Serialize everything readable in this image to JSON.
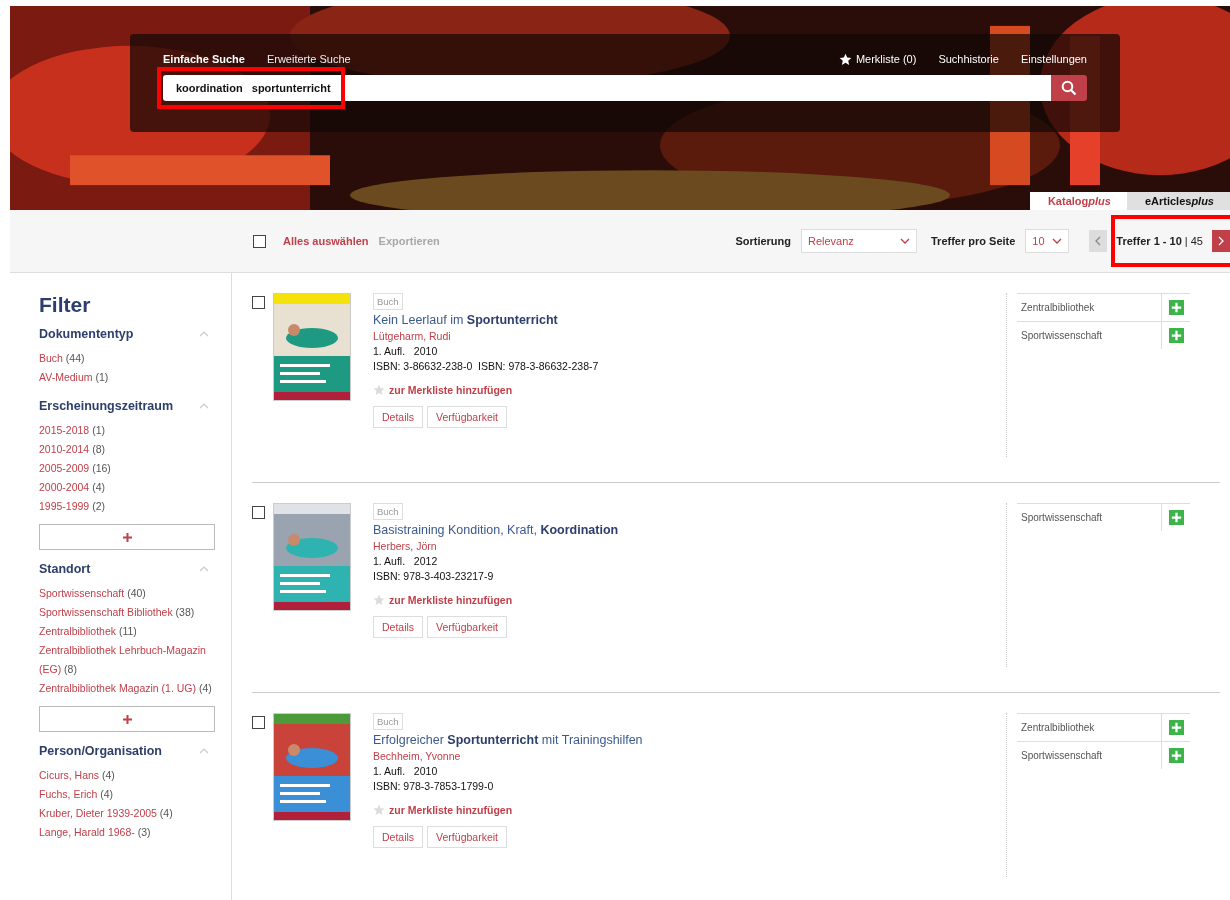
{
  "search": {
    "tabs": [
      {
        "label": "Einfache Suche",
        "selected": true
      },
      {
        "label": "Erweiterte Suche",
        "selected": false
      }
    ],
    "links": [
      {
        "label": "Merkliste (0)",
        "kind": "star"
      },
      {
        "label": "Suchhistorie",
        "kind": "plain"
      },
      {
        "label": "Einstellungen",
        "kind": "plain"
      }
    ],
    "value": "koordination   sportunterricht",
    "highlighted": true
  },
  "catalog_tabs": [
    {
      "label": "Katalog",
      "suffix": "plus",
      "selected": true
    },
    {
      "label": "eArticles",
      "suffix": "plus",
      "selected": false
    }
  ],
  "toolbar": {
    "select_all": {
      "label": "Alles auswählen",
      "checked": false
    },
    "export": {
      "label": "Exportieren",
      "disabled": true
    },
    "sort_label": "Sortierung",
    "sort_value": "Relevanz",
    "per_page_label": "Treffer pro Seite",
    "per_page_value": "10",
    "hits_range": "Treffer 1 - 10",
    "hits_total": "| 45",
    "hits_highlighted": true
  },
  "filter": {
    "title": "Filter",
    "groups": [
      {
        "title": "Dokumententyp",
        "expanded": true,
        "more": false,
        "items": [
          {
            "label": "Buch",
            "count": "(44)"
          },
          {
            "label": "AV-Medium",
            "count": "(1)"
          }
        ]
      },
      {
        "title": "Erscheinungszeitraum",
        "expanded": true,
        "more": true,
        "items": [
          {
            "label": "2015-2018",
            "count": "(1)"
          },
          {
            "label": "2010-2014",
            "count": "(8)"
          },
          {
            "label": "2005-2009",
            "count": "(16)"
          },
          {
            "label": "2000-2004",
            "count": "(4)"
          },
          {
            "label": "1995-1999",
            "count": "(2)"
          }
        ]
      },
      {
        "title": "Standort",
        "expanded": true,
        "more": true,
        "items": [
          {
            "label": "Sportwissenschaft",
            "count": "(40)"
          },
          {
            "label": "Sportwissenschaft Bibliothek",
            "count": "(38)"
          },
          {
            "label": "Zentralbibliothek",
            "count": "(11)"
          },
          {
            "label": "Zentralbibliothek Lehrbuch-Magazin (EG)",
            "count": "(8)"
          },
          {
            "label": "Zentralbibliothek Magazin (1. UG)",
            "count": "(4)"
          }
        ]
      },
      {
        "title": "Person/Organisation",
        "expanded": true,
        "more": false,
        "items": [
          {
            "label": "Cicurs, Hans",
            "count": "(4)"
          },
          {
            "label": "Fuchs, Erich",
            "count": "(4)"
          },
          {
            "label": "Kruber, Dieter 1939-2005",
            "count": "(4)"
          },
          {
            "label": "Lange, Harald 1968-",
            "count": "(3)"
          }
        ]
      }
    ]
  },
  "results": [
    {
      "checked": false,
      "type": "Buch",
      "title": "Kein Leerlauf im **Sportunterricht**",
      "author": "Lütgeharm, Rudi",
      "edition": "1. Aufl.   2010",
      "isbn": "ISBN: 3-86632-238-0  ISBN: 978-3-86632-238-7",
      "watch": "zur Merkliste hinzufügen",
      "buttons": [
        "Details",
        "Verfügbarkeit"
      ],
      "holdings": [
        "Zentralbibliothek",
        "Sportwissenschaft"
      ],
      "cover": {
        "kind": "picture"
      }
    },
    {
      "checked": false,
      "type": "Buch",
      "title": "Basistraining Kondition, Kraft, **Koordination**",
      "author": "Herbers, Jörn",
      "edition": "1. Aufl.   2012",
      "isbn": "ISBN: 978-3-403-23217-9",
      "watch": "zur Merkliste hinzufügen",
      "buttons": [
        "Details",
        "Verfügbarkeit"
      ],
      "holdings": [
        "Sportwissenschaft"
      ],
      "cover": {
        "kind": "picture"
      }
    },
    {
      "checked": false,
      "type": "Buch",
      "title": "Erfolgreicher **Sportunterricht** mit Trainingshilfen",
      "author": "Bechheim, Yvonne",
      "edition": "1. Aufl.   2010",
      "isbn": "ISBN: 978-3-7853-1799-0",
      "watch": "zur Merkliste hinzufügen",
      "buttons": [
        "Details",
        "Verfügbarkeit"
      ],
      "holdings": [
        "Zentralbibliothek",
        "Sportwissenschaft"
      ],
      "cover": {
        "kind": "picture"
      }
    }
  ]
}
